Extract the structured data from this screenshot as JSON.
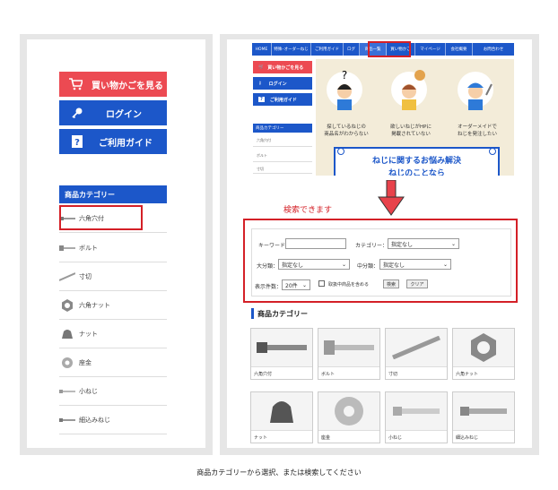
{
  "left": {
    "cart_button": "買い物かごを見る",
    "login_button": "ログイン",
    "guide_button": "ご利用ガイド",
    "category_header": "商品カテゴリー",
    "categories": [
      "六角穴付",
      "ボルト",
      "寸切",
      "六角ナット",
      "ナット",
      "座金",
      "小ねじ",
      "細込みねじ"
    ]
  },
  "right": {
    "nav": [
      "HOME",
      "特殊･オーダーねじ",
      "ご利用ガイド",
      "ログ",
      "商品一覧",
      "買い物かご",
      "マイページ",
      "会社概要",
      "お問合わせ"
    ],
    "mini_cart": "買い物かごを見る",
    "mini_login": "ログイン",
    "mini_guide": "ご利用ガイド",
    "mini_cat_header": "商品カテゴリー",
    "mini_cats": [
      "六角穴付",
      "ボルト",
      "寸切"
    ],
    "banner_captions": [
      "探しているねじの\n商品名がわからない",
      "欲しいねじがHPに\n掲載されていない",
      "オーダーメイドで\nねじを発注したい"
    ],
    "banner_title": "ねじに関するお悩み解決",
    "banner_subtitle": "ねじのことなら",
    "search_note": "検索できます",
    "form": {
      "keyword_label": "キーワード：",
      "category_label": "カテゴリー：",
      "category_value": "指定なし",
      "major_label": "大分類：",
      "major_value": "指定なし",
      "middle_label": "中分類：",
      "middle_value": "指定なし",
      "count_label": "表示件数：",
      "count_value": "20件",
      "include_label": "取扱中商品を含める",
      "search_button": "検索",
      "clear_button": "クリア"
    },
    "grid_header": "商品カテゴリー",
    "grid": [
      "六角穴付",
      "ボルト",
      "寸切",
      "六角ナット",
      "ナット",
      "座金",
      "小ねじ",
      "細込みねじ"
    ]
  },
  "caption": "商品カテゴリーから選択、または検索してください",
  "colors": {
    "red": "#e8424b",
    "blue": "#1c57c9",
    "highlight": "#d42027"
  }
}
